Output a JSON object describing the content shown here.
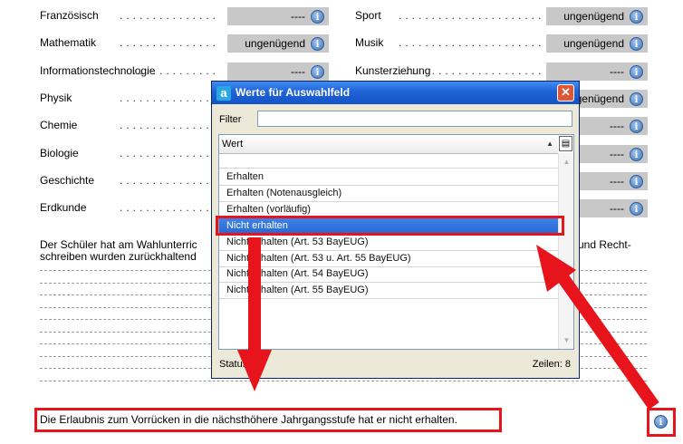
{
  "left_subjects": [
    {
      "label": "Französisch",
      "value": "----"
    },
    {
      "label": "Mathematik",
      "value": "ungenügend"
    },
    {
      "label": "Informationstechnologie",
      "value": "----"
    },
    {
      "label": "Physik",
      "value": ""
    },
    {
      "label": "Chemie",
      "value": ""
    },
    {
      "label": "Biologie",
      "value": ""
    },
    {
      "label": "Geschichte",
      "value": ""
    },
    {
      "label": "Erdkunde",
      "value": ""
    }
  ],
  "right_subjects": [
    {
      "label": "Sport",
      "value": "ungenügend"
    },
    {
      "label": "Musik",
      "value": "ungenügend"
    },
    {
      "label": "Kunsterziehung",
      "value": "----"
    },
    {
      "label": "",
      "value": "ungenügend"
    },
    {
      "label": "",
      "value": "----"
    },
    {
      "label": "",
      "value": "----"
    },
    {
      "label": "",
      "value": "----"
    },
    {
      "label": "",
      "value": "----"
    }
  ],
  "info_glyph": "i",
  "remark": {
    "line1_left": "Der Schüler hat am Wahlunterric",
    "line1_right": "und Recht-",
    "line2": "schreiben wurden zurückhaltend"
  },
  "bottom_sentence": "Die Erlaubnis zum Vorrücken in die nächsthöhere Jahrgangsstufe hat er nicht erhalten.",
  "dialog": {
    "logo_glyph": "a",
    "title": "Werte für Auswahlfeld",
    "close_glyph": "✕",
    "filter_label": "Filter",
    "filter_value": "",
    "column_header": "Wert",
    "sort_glyph": "▲",
    "column_menu_glyph": "▤",
    "items": [
      "",
      "Erhalten",
      "Erhalten (Notenausgleich)",
      "Erhalten (vorläufig)",
      "Nicht erhalten",
      "Nicht erhalten (Art. 53 BayEUG)",
      "Nicht erhalten (Art. 53 u. Art. 55 BayEUG)",
      "Nicht erhalten (Art. 54 BayEUG)",
      "Nicht erhalten (Art. 55 BayEUG)"
    ],
    "selected_index": 4,
    "status_label": "Status",
    "row_count": "Zeilen: 8"
  },
  "colors": {
    "highlight": "#e8141b",
    "selection": "#2a68d3",
    "titlebar": "#1f62d7",
    "grade_box": "#c8c8c8"
  }
}
